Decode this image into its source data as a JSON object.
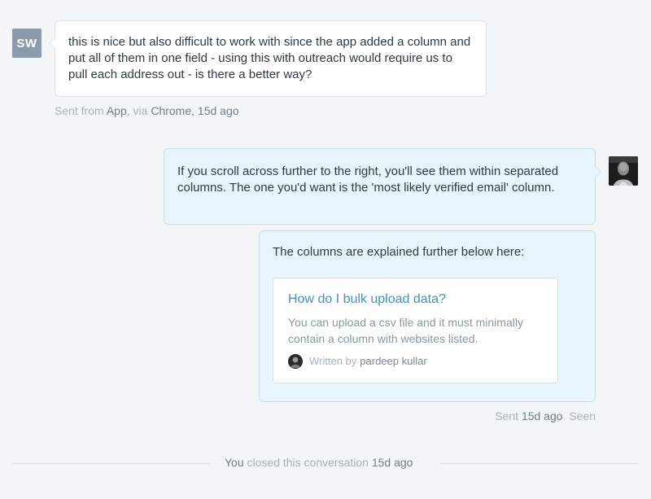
{
  "incoming": {
    "avatar_initials": "SW",
    "text": "this is nice but also difficult to work with since the app added a column and put all of them in one field - using this with outreach would require us to pull each address out - is there a better way?",
    "meta": {
      "sent_from": "Sent from",
      "app": "App",
      "via": ", via",
      "browser": "Chrome",
      "time": ", 15d ago"
    }
  },
  "outgoing": {
    "avatar_icon": "agent-photo",
    "message_1": "If you scroll across further to the right, you'll see them within separated columns. The one you'd want is the 'most likely verified email' column.",
    "message_2": "The columns are explained further below here:",
    "article": {
      "title": "How do I bulk upload data?",
      "description": "You can upload a csv file and it must minimally contain a column with websites listed.",
      "written_by": "Written by",
      "author": "pardeep kullar"
    },
    "meta": {
      "sent": "Sent",
      "time": "15d ago",
      "seen": ". Seen"
    }
  },
  "closed": {
    "actor": "You",
    "action": "closed this conversation",
    "time": "15d ago"
  },
  "colors": {
    "background": "#f3f6f8",
    "agent_bubble": "#e9f5fc",
    "customer_bubble": "#ffffff",
    "link": "#3f93c7",
    "avatar_initials_bg": "#8b9bab"
  }
}
